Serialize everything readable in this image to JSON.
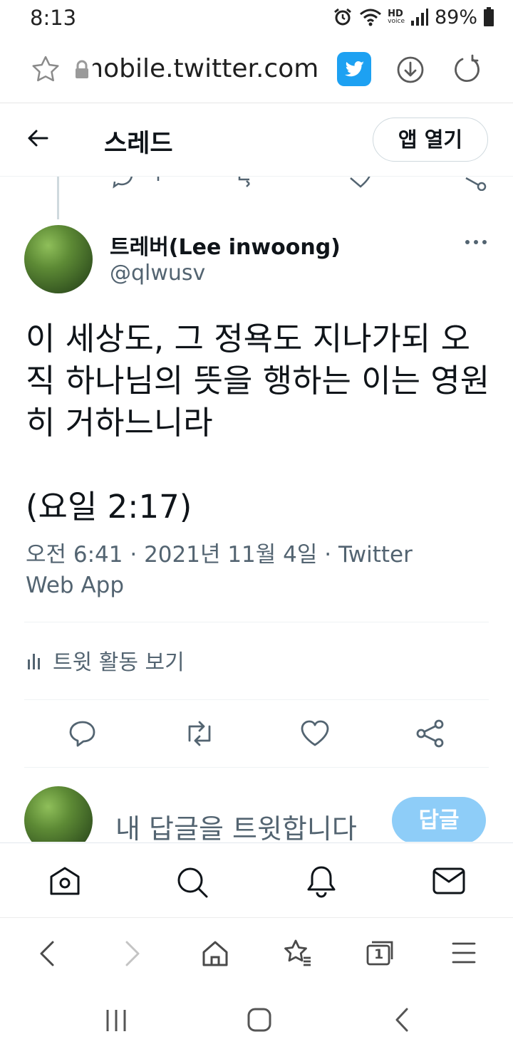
{
  "status_bar": {
    "time": "8:13",
    "hd_label": "HD",
    "voice_label": "voice",
    "battery": "89%"
  },
  "url_bar": {
    "url_text": "mobile.twitter.com",
    "icons": [
      "star-icon",
      "lock-icon",
      "twitter-bird-icon",
      "download-icon",
      "reload-icon"
    ],
    "twitter_color": "#1da1f2"
  },
  "header": {
    "title": "스레드",
    "open_app_label": "앱 열기"
  },
  "tweet": {
    "author_name": "트레버(Lee inwoong)",
    "author_handle": "@qlwusv",
    "text": "이 세상도, 그 정욕도 지나가되 오직 하나님의 뜻을 행하는 이는 영원히 거하느니라\n\n(요일 2:17)",
    "timestamp": "오전 6:41 · 2021년 11월 4일 · Twitter Web App",
    "analytics_label": "트윗 활동 보기",
    "action_icons": [
      "reply-icon",
      "retweet-icon",
      "like-icon",
      "share-icon"
    ]
  },
  "reply": {
    "placeholder": "내 답글을 트윗합니다",
    "button_label": "답글"
  },
  "twitter_nav": [
    "home-icon",
    "search-icon",
    "notifications-icon",
    "messages-icon"
  ],
  "browser_nav": {
    "icons": [
      "back-icon",
      "forward-icon",
      "home-icon",
      "bookmarks-icon",
      "tabs-icon",
      "menu-icon"
    ],
    "tab_count": "1"
  },
  "colors": {
    "text_primary": "#0f1419",
    "text_secondary": "#536471",
    "reply_button": "#8ecdf8"
  }
}
